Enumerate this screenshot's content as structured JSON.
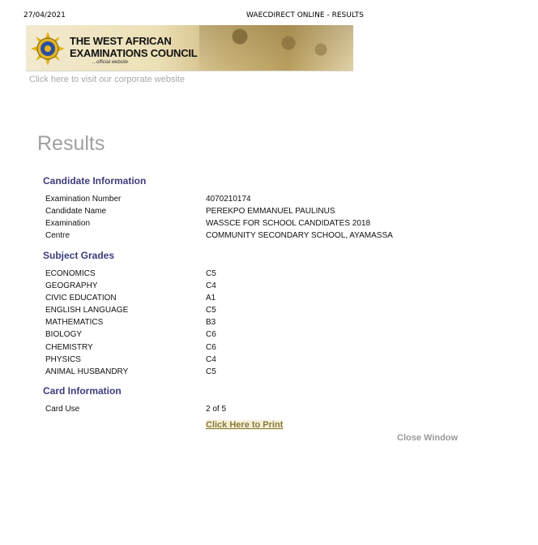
{
  "print_header": {
    "date": "27/04/2021",
    "title": "WAECDIRECT ONLINE - RESULTS"
  },
  "banner": {
    "org_line1": "THE WEST AFRICAN",
    "org_line2": "EXAMINATIONS COUNCIL",
    "tagline": "...official website",
    "logo_icon": "waec-crest-icon"
  },
  "corporate_link": "Click here to visit our corporate website",
  "page_title": "Results",
  "candidate": {
    "heading": "Candidate Information",
    "rows": [
      {
        "label": "Examination Number",
        "value": "4070210174"
      },
      {
        "label": "Candidate Name",
        "value": "PEREKPO EMMANUEL PAULINUS"
      },
      {
        "label": "Examination",
        "value": "WASSCE FOR SCHOOL CANDIDATES 2018"
      },
      {
        "label": "Centre",
        "value": "COMMUNITY SECONDARY SCHOOL, AYAMASSA"
      }
    ]
  },
  "grades": {
    "heading": "Subject Grades",
    "rows": [
      {
        "subject": "ECONOMICS",
        "grade": "C5"
      },
      {
        "subject": "GEOGRAPHY",
        "grade": "C4"
      },
      {
        "subject": "CIVIC EDUCATION",
        "grade": "A1"
      },
      {
        "subject": "ENGLISH LANGUAGE",
        "grade": "C5"
      },
      {
        "subject": "MATHEMATICS",
        "grade": "B3"
      },
      {
        "subject": "BIOLOGY",
        "grade": "C6"
      },
      {
        "subject": "CHEMISTRY",
        "grade": "C6"
      },
      {
        "subject": "PHYSICS",
        "grade": "C4"
      },
      {
        "subject": "ANIMAL HUSBANDRY",
        "grade": "C5"
      }
    ]
  },
  "card": {
    "heading": "Card Information",
    "label": "Card Use",
    "value": "2 of 5"
  },
  "actions": {
    "print": "Click Here to Print",
    "close": "Close Window"
  }
}
